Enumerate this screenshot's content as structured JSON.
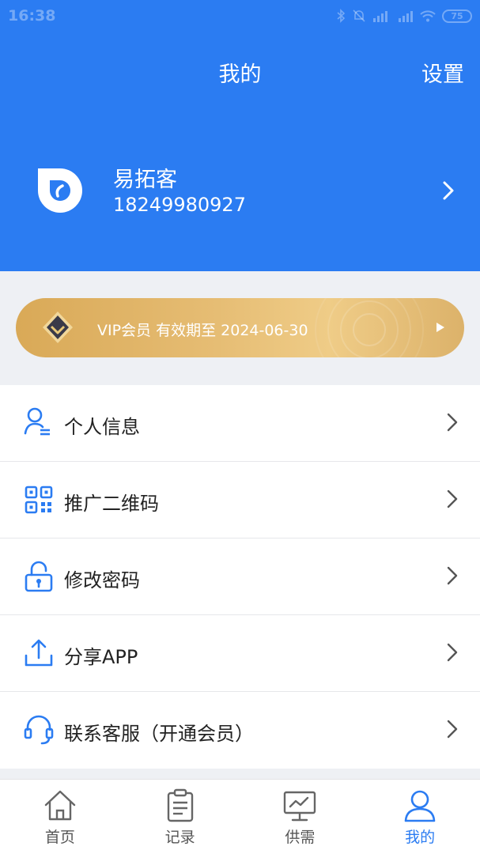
{
  "status_bar": {
    "time": "16:38",
    "battery": "75"
  },
  "header": {
    "title": "我的",
    "settings_label": "设置"
  },
  "profile": {
    "name": "易拓客",
    "phone": "18249980927"
  },
  "vip": {
    "text": "VIP会员 有效期至 2024-06-30"
  },
  "menu": {
    "items": [
      {
        "label": "个人信息",
        "icon": "user-info-icon"
      },
      {
        "label": "推广二维码",
        "icon": "qr-code-icon"
      },
      {
        "label": "修改密码",
        "icon": "lock-icon"
      },
      {
        "label": "分享APP",
        "icon": "share-icon"
      },
      {
        "label": "联系客服（开通会员）",
        "icon": "headset-icon"
      }
    ]
  },
  "tabs": [
    {
      "label": "首页",
      "icon": "home-icon"
    },
    {
      "label": "记录",
      "icon": "clipboard-icon"
    },
    {
      "label": "供需",
      "icon": "monitor-chart-icon"
    },
    {
      "label": "我的",
      "icon": "person-icon",
      "active": true
    }
  ],
  "colors": {
    "primary": "#2b7cf2",
    "vip_gold": "#e6bd74",
    "background": "#eef0f4"
  }
}
